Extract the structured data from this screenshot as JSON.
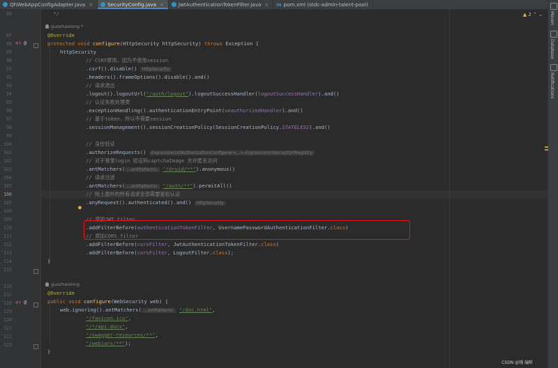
{
  "tabs": [
    {
      "label": "QhWebAppConfigAdapter.java",
      "type": "java",
      "active": false
    },
    {
      "label": "SecurityConfig.java",
      "type": "java",
      "active": true
    },
    {
      "label": "JwtAuthenticationTokenFilter.java",
      "type": "java",
      "active": false
    },
    {
      "label": "pom.xml (stdc-admin-talent-pool)",
      "type": "maven",
      "active": false
    }
  ],
  "tab_close": "×",
  "maven_glyph": "m",
  "side_tools": [
    "Maven",
    "Database",
    "Notifications"
  ],
  "inspection": {
    "icon": "warning-triangle-icon",
    "glyph": "▲",
    "count": "2"
  },
  "nav_arrows": {
    "up": "⌃",
    "down": "⌄"
  },
  "authors": {
    "top": "guozhaolong *",
    "bottom": "guozhaolong"
  },
  "gutter": {
    "lines": [
      "86",
      "",
      "87",
      "88",
      "89",
      "90",
      "91",
      "92",
      "93",
      "94",
      "95",
      "96",
      "97",
      "98",
      "99",
      "100",
      "101",
      "102",
      "103",
      "104",
      "105",
      "106",
      "107",
      "108",
      "109",
      "110",
      "111",
      "112",
      "113",
      "114",
      "",
      "115",
      "116",
      "117",
      "118",
      "119",
      "120",
      "121",
      "122",
      "123"
    ],
    "current_line": "106",
    "override_glyph": "⊙↑",
    "annotation_glyph": "@"
  },
  "code": {
    "l86": "    */",
    "l87_annot": "@Override",
    "l88_kw1": "protected void ",
    "l88_fn": "configure",
    "l88_params": "(HttpSecurity httpSecurity) ",
    "l88_kw2": "throws ",
    "l88_rest": "Exception {",
    "l89": "httpSecurity",
    "l90": "// CSRF禁用，因为不使用session",
    "l91_code": ".csrf().disable()",
    "l91_hint": "HttpSecurity",
    "l92": ".headers().frameOptions().disable().and()",
    "l93": "// 请求退出",
    "l94_a": ".logout().logoutUrl(",
    "l94_str": "\"/auth/logout\"",
    "l94_b": ").logoutSuccessHandler(",
    "l94_fld": "logoutSuccessHandler",
    "l94_c": ").and()",
    "l95": "// 认证失败处理类",
    "l96_a": ".exceptionHandling().authenticationEntryPoint(",
    "l96_fld": "unauthorizedHandler",
    "l96_b": ").and()",
    "l97": "// 基于token，所以不需要session",
    "l98_a": ".sessionManagement().sessionCreationPolicy(SessionCreationPolicy.",
    "l98_cst": "STATELESS",
    "l98_b": ").and()",
    "l100": "// 身份验证",
    "l101_code": ".authorizeRequests()",
    "l101_hint": "ExpressionUrlAuthorizationConfigurer<...>.ExpressionInterceptUrlRegistry",
    "l102": "// 对于登录login 验证码captchaImage 允许匿名访问",
    "l103_a": ".antMatchers(",
    "l103_hint": "...antPatterns:",
    "l103_str": "\"/druid/**\"",
    "l103_b": ").anonymous()",
    "l104": "// 请求过滤",
    "l105_a": ".antMatchers(",
    "l105_hint": "...antPatterns:",
    "l105_str": "\"/auth/**\"",
    "l105_b": ").permitAll()",
    "l106": "// 除上面外的所有请求全部需要鉴权认证",
    "l107_code": ".anyRequest().authenticated().and()",
    "l107_hint": "HttpSecurity",
    "l109": "// 添加JWT filter",
    "l110_a": ".addFilterBefore(",
    "l110_fld": "authenticationTokenFilter",
    "l110_b": ", UsernamePasswordAuthenticationFilter.",
    "l110_kw": "class",
    "l110_c": ")",
    "l111": "// 添加CORS filter",
    "l112_a": ".addFilterBefore(",
    "l112_fld": "corsFilter",
    "l112_b": ", JwtAuthenticationTokenFilter.",
    "l112_kw": "class",
    "l112_c": ")",
    "l113_a": ".addFilterBefore(",
    "l113_fld": "corsFilter",
    "l113_b": ", LogoutFilter.",
    "l113_kw": "class",
    "l113_c": ");",
    "l114": "}",
    "l116_annot": "@Override",
    "l117_kw": "public void ",
    "l117_fn": "configure",
    "l117_rest": "(WebSecurity web) {",
    "l118_a": "web.ignoring().antMatchers(",
    "l118_hint": "...antPatterns:",
    "l118_str": "\"/doc.html\"",
    "l118_b": ",",
    "l119_str": "\"/favicon.ico\"",
    "l119_b": ",",
    "l120_str": "\"/*/api-docs\"",
    "l120_b": ",",
    "l121_str": "\"/swagger-resources/**\"",
    "l121_b": ",",
    "l122_str": "\"/webjars/**\"",
    "l122_b": ");",
    "l123": "}"
  },
  "watermark": "CSDN @钱 瑞听"
}
